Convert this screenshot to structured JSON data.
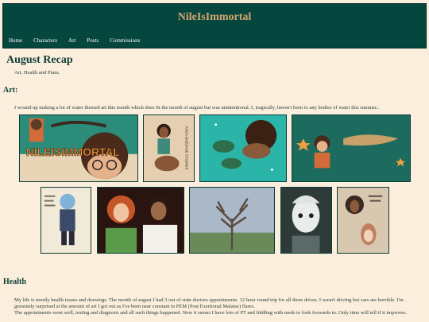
{
  "site": {
    "title": "NileIsImmortal"
  },
  "nav": [
    "Home",
    "Characters",
    "Art",
    "Posts",
    "Commissions"
  ],
  "post": {
    "title": "August Recap",
    "subtitle": "Art, Health and Plans."
  },
  "art_section": {
    "heading": "Art:",
    "text": "I wound up making a lot of water themed art this month which does fit the month of august but was unintentional. I, tragically, haven't been to any bodies of water this summer..",
    "banner_text": "NILEISIMMORTAL",
    "merch_text": "ANCA GUEZASE STUDIOS"
  },
  "health_section": {
    "heading": "Health",
    "para1": "My life is mostly health issues and drawings. The month of august I had 3 out of state doctors appointments. 12 hour round trip for all three drives. I wasn't driving but cars are horrible. I'm genuinely surprised at the amount of art I got out as I've been near constant in PEM (Post Exertional Malaise) flares.",
    "para2": "The appointments went well, testing and diagnosis and all such things happened. Now it seems I have lots of PT and fiddling with meds to look forwards to. Only time will tell if it improves."
  },
  "colors": {
    "header_bg": "#05463f",
    "title": "#d7a56d",
    "page_bg": "#fbeedd",
    "heading": "#0b3d36"
  }
}
